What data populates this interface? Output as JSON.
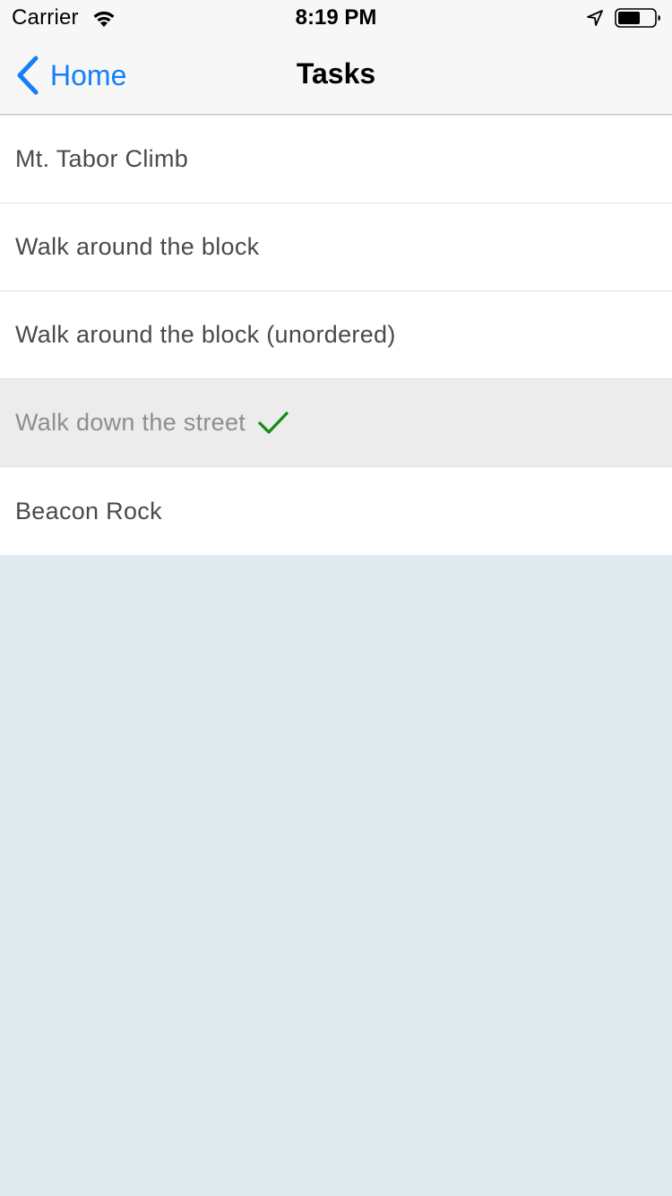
{
  "status_bar": {
    "carrier": "Carrier",
    "time": "8:19 PM",
    "icons": [
      "wifi-icon",
      "location-icon",
      "battery-icon"
    ]
  },
  "nav_bar": {
    "back_label": "Home",
    "title": "Tasks"
  },
  "tasks": [
    {
      "label": "Mt. Tabor Climb",
      "completed": false
    },
    {
      "label": "Walk around the block",
      "completed": false
    },
    {
      "label": "Walk around the block (unordered)",
      "completed": false
    },
    {
      "label": "Walk down the street",
      "completed": true
    },
    {
      "label": "Beacon Rock",
      "completed": false
    }
  ],
  "colors": {
    "accent": "#147efb",
    "check": "#138a13",
    "background": "#e0ebf0",
    "completed_row": "#ececec"
  }
}
